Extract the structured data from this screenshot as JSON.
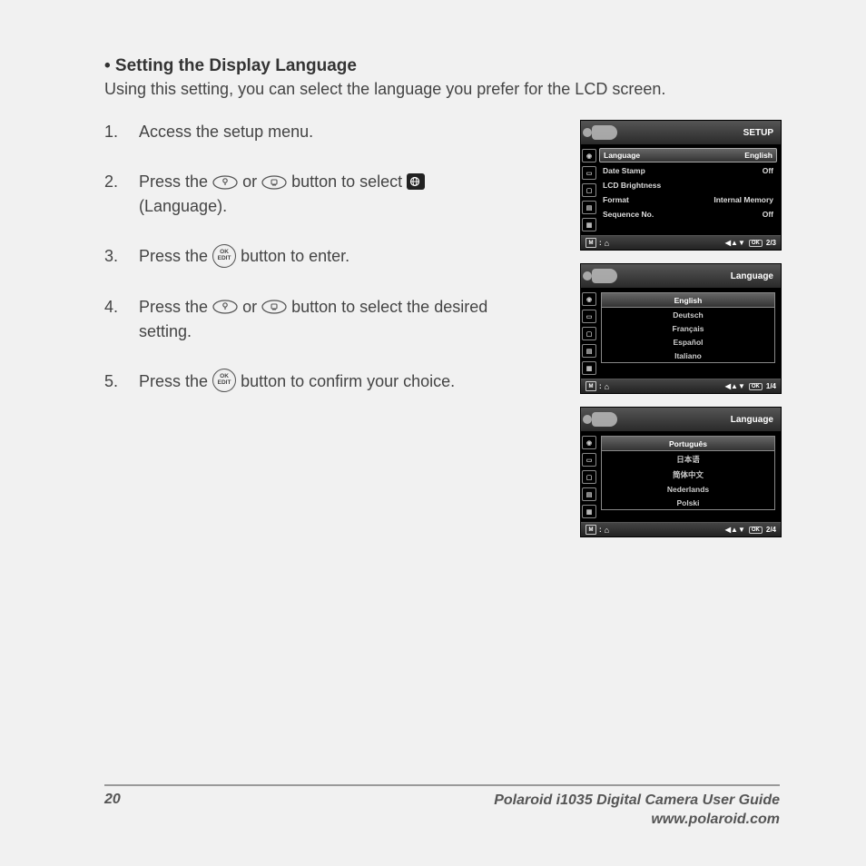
{
  "heading": "• Setting the Display Language",
  "intro": "Using this setting, you can select the language you prefer for the LCD screen.",
  "steps": {
    "s1_num": "1.",
    "s1_text": "Access the setup menu.",
    "s2_num": "2.",
    "s2_a": "Press the ",
    "s2_b": " or ",
    "s2_c": " button to select ",
    "s2_d": " (Language).",
    "s3_num": "3.",
    "s3_a": "Press the ",
    "s3_b": " button to enter.",
    "s4_num": "4.",
    "s4_a": "Press the ",
    "s4_b": " or ",
    "s4_c": " button to select the desired setting.",
    "s5_num": "5.",
    "s5_a": "Press the ",
    "s5_b": " button to confirm your choice."
  },
  "screen1": {
    "title": "SETUP",
    "rows": [
      {
        "label": "Language",
        "value": "English",
        "sel": true
      },
      {
        "label": "Date Stamp",
        "value": "Off"
      },
      {
        "label": "LCD Brightness",
        "value": ""
      },
      {
        "label": "Format",
        "value": "Internal Memory"
      },
      {
        "label": "Sequence No.",
        "value": "Off"
      }
    ],
    "page": "2/3"
  },
  "screen2": {
    "title": "Language",
    "items": [
      {
        "label": "English",
        "sel": true
      },
      {
        "label": "Deutsch"
      },
      {
        "label": "Français"
      },
      {
        "label": "Español"
      },
      {
        "label": "Italiano"
      }
    ],
    "page": "1/4"
  },
  "screen3": {
    "title": "Language",
    "items": [
      {
        "label": "Português",
        "sel": true
      },
      {
        "label": "日本语"
      },
      {
        "label": "简体中文"
      },
      {
        "label": "Nederlands"
      },
      {
        "label": "Polski"
      }
    ],
    "page": "2/4"
  },
  "footer": {
    "page_no": "20",
    "title": "Polaroid i1035 Digital Camera User Guide",
    "url": "www.polaroid.com"
  },
  "nav_arrows": "◀▲▼",
  "ok_label": "OK",
  "m_label": "M",
  "colon": ":"
}
